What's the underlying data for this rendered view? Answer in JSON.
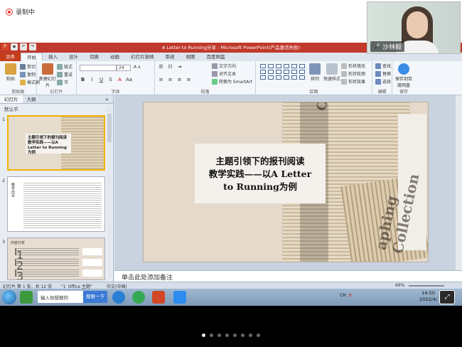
{
  "recording": {
    "label": "录制中"
  },
  "webcam": {
    "name": "沙林毅"
  },
  "window": {
    "title": "A Letter to Running分享 - Microsoft PowerPoint(产品激活失败)"
  },
  "tabs": [
    "文件",
    "开始",
    "插入",
    "设计",
    "切换",
    "动画",
    "幻灯片放映",
    "审阅",
    "视图",
    "百度网盘"
  ],
  "ribbon": {
    "clipboard": {
      "paste": "粘贴",
      "cut": "剪切",
      "copy": "复制",
      "format_painter": "格式刷",
      "label": "剪贴板"
    },
    "slides": {
      "new_slide": "新建幻灯片",
      "layout": "版式",
      "reset": "重设",
      "section": "节",
      "label": "幻灯片"
    },
    "font": {
      "size": "24",
      "label": "字体"
    },
    "paragraph": {
      "text_direction": "文字方向",
      "align_text": "对齐文本",
      "smartart": "转换为 SmartArt",
      "label": "段落"
    },
    "drawing": {
      "arrange": "排列",
      "quick_styles": "快速样式",
      "shape_fill": "形状填充",
      "shape_outline": "形状轮廓",
      "shape_effects": "形状效果",
      "label": "绘图"
    },
    "editing": {
      "find": "查找",
      "replace": "替换",
      "select": "选择",
      "label": "编辑"
    },
    "save": {
      "save_baidu": "保存到百度网盘",
      "label": "保存"
    }
  },
  "left_pane": {
    "tab_slides": "幻灯片",
    "tab_outline": "大纲",
    "section": "默认节",
    "slides": [
      {
        "num": "1",
        "title": "主题引领下的报刊阅读教学实践——以A Letter to Running为例"
      },
      {
        "num": "2",
        "label": "教学内容"
      },
      {
        "num": "3",
        "label": "内容分析",
        "items": [
          "1",
          "2",
          "3"
        ]
      }
    ]
  },
  "slide": {
    "title_line1": "主题引领下的报刊阅读",
    "title_line2": "教学实践——以A Letter",
    "title_line3": "to Running为例",
    "wm1": "Collection",
    "wm2": "aphing Collection"
  },
  "notes": {
    "placeholder": "单击此处添加备注"
  },
  "status": {
    "slide_count": "幻灯片 第 1 张，共 12 张",
    "theme": "\"1_Office 主题\"",
    "language": "中文(中国)",
    "zoom": "66%"
  },
  "taskbar": {
    "search_placeholder": "输入你想搜的",
    "search_button": "搜索一下",
    "time": "14:50",
    "date": "2022/4/",
    "tray": [
      "CH",
      "S"
    ]
  },
  "pager": {
    "count": 8,
    "active": 0
  }
}
